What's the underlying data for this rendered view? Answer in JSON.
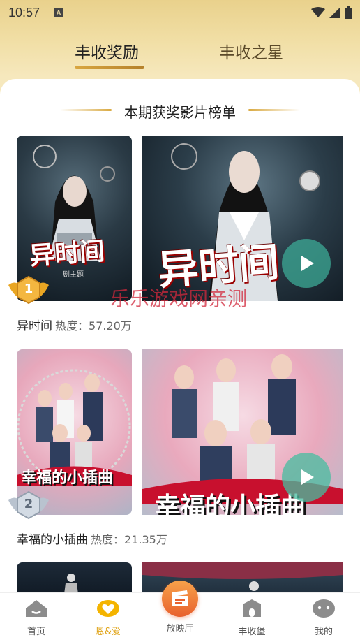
{
  "status_bar": {
    "time": "10:57",
    "notification_glyph": "A"
  },
  "tabs": [
    {
      "label": "丰收奖励",
      "active": true
    },
    {
      "label": "丰收之星",
      "active": false
    }
  ],
  "section_title": "本期获奖影片榜单",
  "movies": [
    {
      "rank": "1",
      "name": "异时间",
      "heat_label": "热度：",
      "heat_value": "57.20万",
      "poster_text": "异时间",
      "poster_sub": "剧主题"
    },
    {
      "rank": "2",
      "name": "幸福的小插曲",
      "heat_label": "热度：",
      "heat_value": "21.35万",
      "poster_text": "幸福的小插曲"
    }
  ],
  "watermark": "乐乐游戏网亲测",
  "bottom_nav": [
    {
      "label": "首页",
      "icon": "home-icon",
      "active": false
    },
    {
      "label": "恩&爱",
      "icon": "heart-icon",
      "active": true
    },
    {
      "label": "放映厅",
      "icon": "clapperboard-icon",
      "active": false
    },
    {
      "label": "丰收堡",
      "icon": "castle-icon",
      "active": false
    },
    {
      "label": "我的",
      "icon": "profile-icon",
      "active": false
    }
  ],
  "colors": {
    "accent": "#e0a418",
    "gold": "#d9a940",
    "center_button": "#f07a3a"
  }
}
